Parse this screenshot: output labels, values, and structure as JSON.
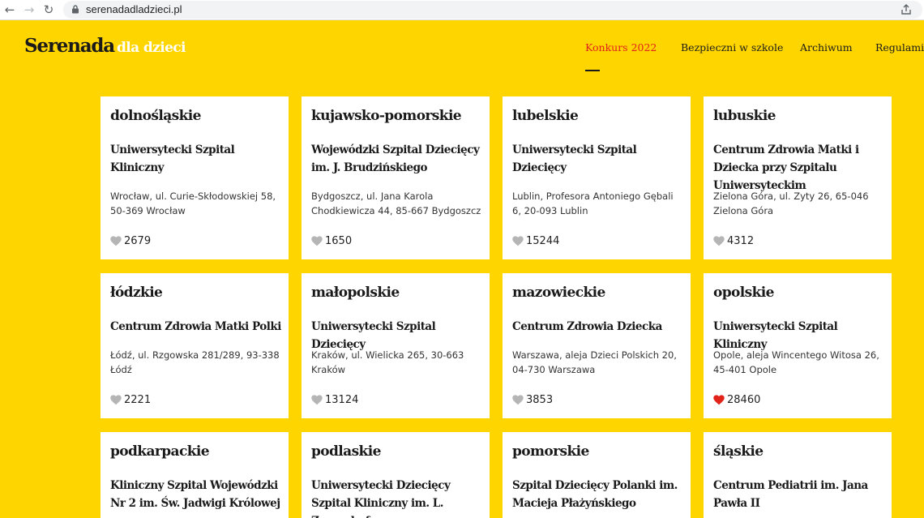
{
  "browser": {
    "url": "serenadadladzieci.pl",
    "back_icon": "arrow-left-icon",
    "forward_icon": "arrow-right-icon",
    "reload_icon": "reload-icon"
  },
  "header": {
    "logo_main": "Serenada",
    "logo_sub": "dla dzieci",
    "menu": [
      {
        "label": "Konkurs 2022",
        "active": true
      },
      {
        "label": "Bezpieczni w szkole",
        "active": false
      },
      {
        "label": "Archiwum",
        "active": false
      },
      {
        "label": "Regulamin",
        "active": false
      }
    ]
  },
  "colors": {
    "background": "#ffd500",
    "accent": "#e2231a",
    "heart_default": "#b5b5b5",
    "heart_liked": "#e2231a"
  },
  "cards": [
    {
      "region": "dolnośląskie",
      "name": "Uniwersytecki Szpital Kliniczny",
      "address": "Wrocław, ul. Curie-Skłodowskiej 58, 50-369 Wrocław",
      "likes": "2679",
      "liked": false
    },
    {
      "region": "kujawsko-pomorskie",
      "name": "Wojewódzki Szpital Dziecięcy im. J. Brudzińskiego",
      "address": "Bydgoszcz, ul. Jana Karola Chodkiewicza 44, 85-667 Bydgoszcz",
      "likes": "1650",
      "liked": false
    },
    {
      "region": "lubelskie",
      "name": "Uniwersytecki Szpital Dziecięcy",
      "address": "Lublin, Profesora Antoniego Gębali 6, 20-093 Lublin",
      "likes": "15244",
      "liked": false
    },
    {
      "region": "lubuskie",
      "name": "Centrum Zdrowia Matki i Dziecka przy Szpitalu Uniwersyteckim",
      "address": "Zielona Góra, ul. Zyty 26, 65-046 Zielona Góra",
      "likes": "4312",
      "liked": false
    },
    {
      "region": "łódzkie",
      "name": "Centrum Zdrowia Matki Polki",
      "address": "Łódź, ul. Rzgowska 281/289, 93-338 Łódź",
      "likes": "2221",
      "liked": false
    },
    {
      "region": "małopolskie",
      "name": "Uniwersytecki Szpital Dziecięcy",
      "address": "Kraków, ul. Wielicka 265, 30-663 Kraków",
      "likes": "13124",
      "liked": false
    },
    {
      "region": "mazowieckie",
      "name": "Centrum Zdrowia Dziecka",
      "address": "Warszawa, aleja Dzieci Polskich 20, 04-730 Warszawa",
      "likes": "3853",
      "liked": false
    },
    {
      "region": "opolskie",
      "name": "Uniwersytecki Szpital Kliniczny",
      "address": "Opole, aleja Wincentego Witosa 26, 45-401 Opole",
      "likes": "28460",
      "liked": true
    },
    {
      "region": "podkarpackie",
      "name": "Kliniczny Szpital Wojewódzki Nr 2 im. Św. Jadwigi Królowej",
      "address": "",
      "likes": "",
      "liked": false
    },
    {
      "region": "podlaskie",
      "name": "Uniwersytecki Dziecięcy Szpital Kliniczny im. L. Zamenhofa",
      "address": "",
      "likes": "",
      "liked": false
    },
    {
      "region": "pomorskie",
      "name": "Szpital Dziecięcy Polanki im. Macieja Płażyńskiego",
      "address": "",
      "likes": "",
      "liked": false
    },
    {
      "region": "śląskie",
      "name": "Centrum Pediatrii im. Jana Pawła II",
      "address": "",
      "likes": "",
      "liked": false
    }
  ]
}
